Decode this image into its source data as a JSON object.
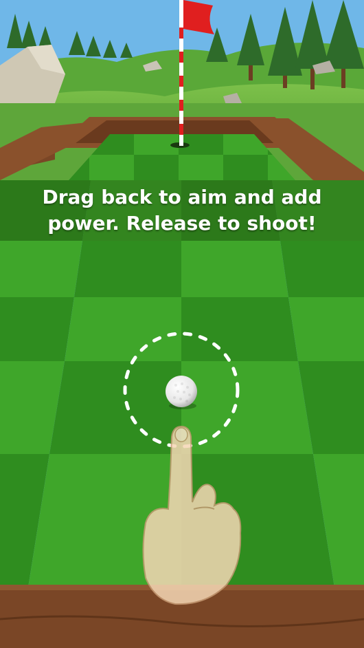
{
  "hud": {
    "tutorial_text": "Drag back to aim and add power. Release to shoot!"
  },
  "colors": {
    "sky": "#6fb7e8",
    "grass_light": "#3fa62a",
    "grass_dark": "#2f8d1f",
    "wall": "#7a4626",
    "flag": "#e01f1f",
    "ball": "#f2f2f2"
  },
  "icons": {
    "ball": "golf-ball-icon",
    "hand": "pointing-hand-icon",
    "flag": "flag-icon",
    "aim": "aim-circle-icon"
  }
}
